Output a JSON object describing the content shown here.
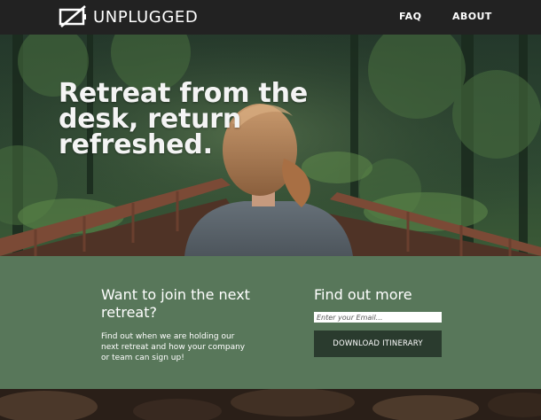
{
  "nav": {
    "brand": "UNPLUGGED",
    "brand_icon": "unplugged-battery-icon",
    "links": [
      {
        "label": "FAQ"
      },
      {
        "label": "ABOUT"
      }
    ]
  },
  "hero": {
    "title_lines": [
      "Retreat from the",
      "desk, return",
      "refreshed."
    ],
    "image": "woman-on-wooden-bridge-in-forest"
  },
  "signup": {
    "heading": "Want to join the next retreat?",
    "body": "Find out when we are holding our next retreat and how your company or team can sign up!"
  },
  "find_more": {
    "heading": "Find out more",
    "email_placeholder": "Enter your Email...",
    "button_label": "DOWNLOAD ITINERARY"
  },
  "colors": {
    "nav_bg": "#222222",
    "band_bg": "#58775a",
    "button_bg": "#2a3b2e"
  }
}
